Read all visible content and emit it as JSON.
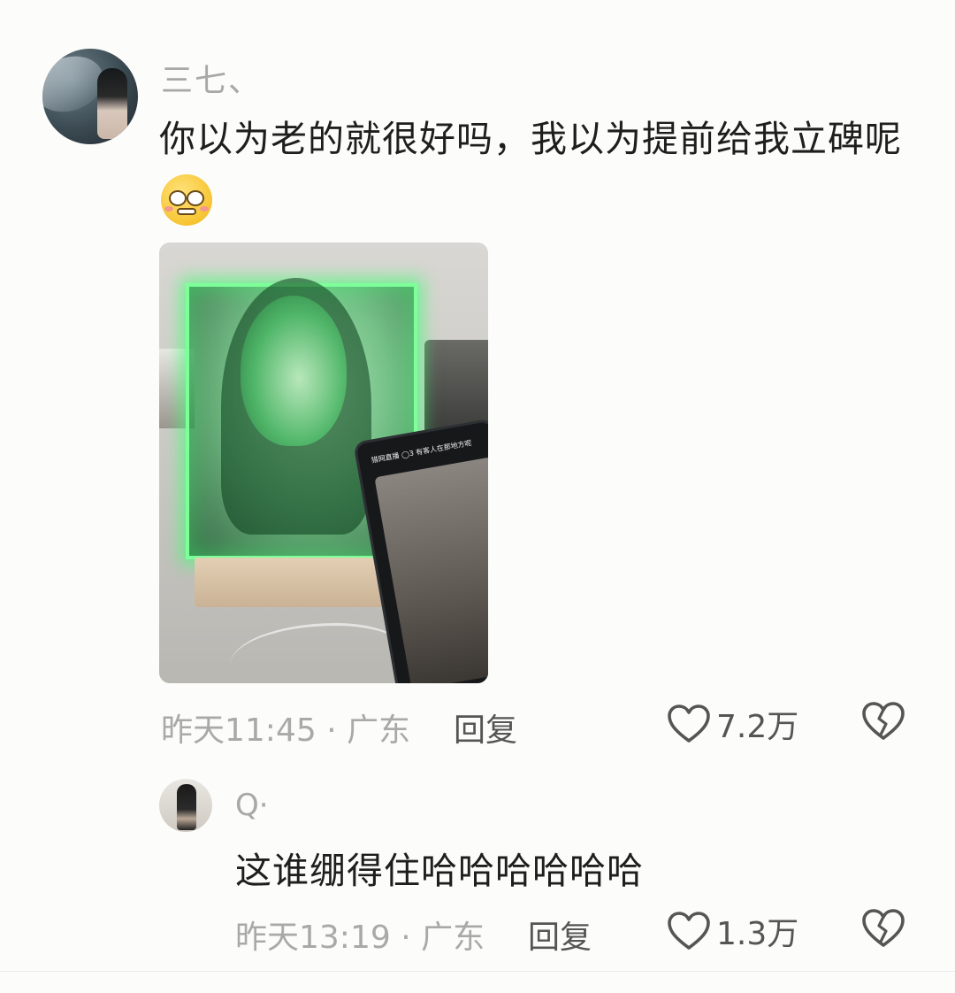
{
  "comment": {
    "username": "三七、",
    "text": "你以为老的就很好吗，我以为提前给我立碑呢",
    "emoji": "pleading-face-emoji",
    "time_location": "昨天11:45 · 广东",
    "reply_label": "回复",
    "like_count": "7.2万",
    "photo": {
      "tablet_bar_text": "猎网直播 ◯3   有客人在那地方呢"
    }
  },
  "reply": {
    "username": "Q·",
    "text": "这谁绷得住哈哈哈哈哈哈",
    "time_location": "昨天13:19 · 广东",
    "reply_label": "回复",
    "like_count": "1.3万"
  },
  "icons": {
    "like": "heart-outline-icon",
    "dislike": "broken-heart-icon"
  },
  "colors": {
    "text_primary": "#1e1e1e",
    "text_secondary": "#a9a9a9",
    "action": "#555555",
    "glow": "#7dff9a"
  }
}
